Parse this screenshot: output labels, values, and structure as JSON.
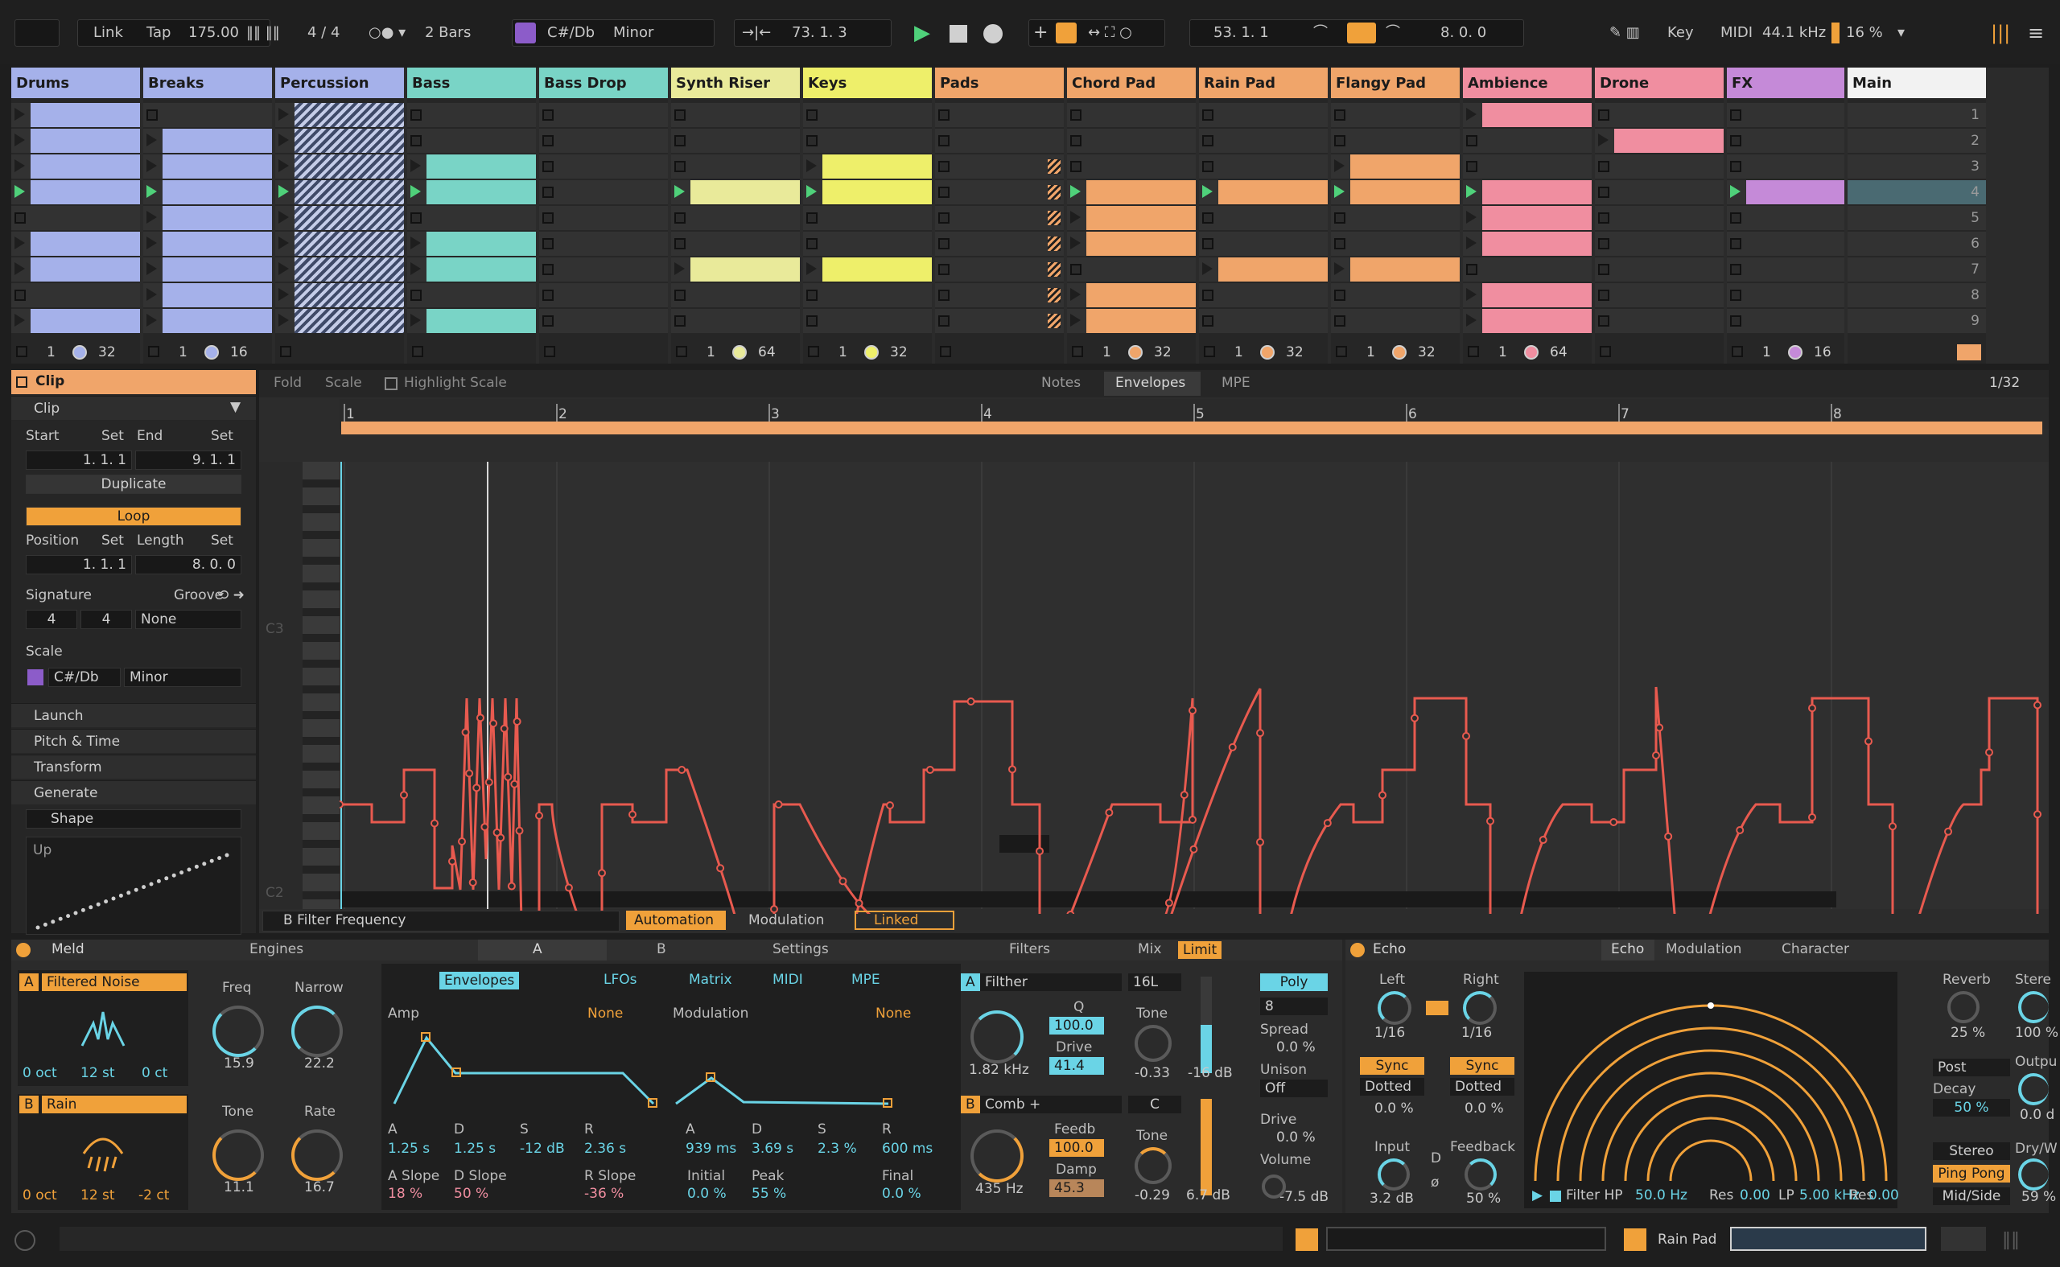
{
  "topbar": {
    "link": "Link",
    "tap": "Tap",
    "tempo": "175.00",
    "time_sig": "4 / 4",
    "quantize": "2 Bars",
    "key": "C#/Db",
    "scale": "Minor",
    "position": "73.   1.   3",
    "loop_start": "53.   1.   1",
    "loop_length": "8.   0.   0",
    "key_map": "Key",
    "midi_map": "MIDI",
    "sample_rate": "44.1 kHz",
    "cpu": "16 %"
  },
  "tracks": [
    {
      "name": "Drums",
      "color": "#a5b1ea",
      "slots": [
        1,
        1,
        1,
        1,
        0,
        1,
        1,
        0,
        1
      ],
      "playing": 3,
      "footer_num": "1",
      "footer_count": "32",
      "dot": "#a5b1ea"
    },
    {
      "name": "Breaks",
      "color": "#a5b1ea",
      "slots": [
        0,
        1,
        1,
        1,
        1,
        1,
        1,
        1,
        1
      ],
      "playing": 3,
      "footer_num": "1",
      "footer_count": "16",
      "dot": "#a5b1ea"
    },
    {
      "name": "Percussion",
      "color": "#a5b1ea",
      "hatch": true,
      "slots": [
        1,
        1,
        1,
        1,
        1,
        1,
        1,
        1,
        1
      ],
      "playing": 3,
      "footer_num": "",
      "footer_count": "",
      "dot": ""
    },
    {
      "name": "Bass",
      "color": "#79d4c6",
      "slots": [
        0,
        0,
        1,
        1,
        0,
        1,
        1,
        0,
        1
      ],
      "playing": 3,
      "footer_num": "",
      "footer_count": "",
      "dot": ""
    },
    {
      "name": "Bass Drop",
      "color": "#79d4c6",
      "slots": [
        0,
        0,
        0,
        0,
        0,
        0,
        0,
        0,
        0
      ],
      "playing": -1,
      "footer_num": "",
      "footer_count": "",
      "dot": ""
    },
    {
      "name": "Synth Riser",
      "color": "#e9ea9a",
      "slots": [
        0,
        0,
        0,
        1,
        0,
        0,
        1,
        0,
        0
      ],
      "playing": 3,
      "footer_num": "1",
      "footer_count": "64",
      "dot": "#e9ea9a"
    },
    {
      "name": "Keys",
      "color": "#eeef6a",
      "slots": [
        0,
        0,
        1,
        1,
        0,
        0,
        1,
        0,
        0
      ],
      "playing": 3,
      "footer_num": "1",
      "footer_count": "32",
      "dot": "#eeef6a"
    },
    {
      "name": "Pads",
      "color": "#f0a56a",
      "stripes": true,
      "slots": [
        0,
        0,
        0,
        0,
        0,
        0,
        0,
        0,
        0
      ],
      "playing": -1,
      "footer_num": "",
      "footer_count": "",
      "dot": ""
    },
    {
      "name": "Chord Pad",
      "color": "#f0a56a",
      "slots": [
        0,
        0,
        0,
        1,
        1,
        1,
        0,
        1,
        1
      ],
      "playing": 3,
      "footer_num": "1",
      "footer_count": "32",
      "dot": "#f0a56a"
    },
    {
      "name": "Rain Pad",
      "color": "#f0a56a",
      "slots": [
        0,
        0,
        0,
        1,
        0,
        0,
        1,
        0,
        0
      ],
      "playing": 3,
      "footer_num": "1",
      "footer_count": "32",
      "dot": "#f0a56a"
    },
    {
      "name": "Flangy Pad",
      "color": "#f0a56a",
      "slots": [
        0,
        0,
        1,
        1,
        0,
        0,
        1,
        0,
        0
      ],
      "playing": 3,
      "footer_num": "1",
      "footer_count": "32",
      "dot": "#f0a56a"
    },
    {
      "name": "Ambience",
      "color": "#f08ea0",
      "slots": [
        1,
        0,
        0,
        1,
        1,
        1,
        0,
        1,
        1
      ],
      "playing": 3,
      "footer_num": "1",
      "footer_count": "64",
      "dot": "#f08ea0"
    },
    {
      "name": "Drone",
      "color": "#f08ea0",
      "slots": [
        0,
        1,
        0,
        0,
        0,
        0,
        0,
        0,
        0
      ],
      "playing": -1,
      "footer_num": "",
      "footer_count": "",
      "dot": ""
    },
    {
      "name": "FX",
      "color": "#c58ad8",
      "slots": [
        0,
        0,
        0,
        1,
        0,
        0,
        0,
        0,
        0
      ],
      "playing": 3,
      "footer_num": "1",
      "footer_count": "16",
      "dot": "#c58ad8"
    },
    {
      "name": "Main",
      "color": "#f2f2f2",
      "slots": [
        0,
        0,
        0,
        0,
        0,
        0,
        0,
        0,
        0
      ],
      "playing": -1,
      "footer_num": "",
      "footer_count": "",
      "dot": ""
    }
  ],
  "scenes": [
    "1",
    "2",
    "3",
    "4",
    "5",
    "6",
    "7",
    "8",
    "9"
  ],
  "clip_panel": {
    "title": "Clip",
    "section": "Clip",
    "start_label": "Start",
    "end_label": "End",
    "set": "Set",
    "start": "1.   1.   1",
    "end": "9.   1.   1",
    "duplicate": "Duplicate",
    "loop": "Loop",
    "position_label": "Position",
    "length_label": "Length",
    "position": "1.   1.   1",
    "length": "8.   0.   0",
    "signature_label": "Signature",
    "groove_label": "Groove",
    "sig_num": "4",
    "sig_den": "4",
    "groove": "None",
    "scale_label": "Scale",
    "scale_key": "C#/Db",
    "scale_mode": "Minor",
    "sections": [
      "Launch",
      "Pitch & Time",
      "Transform",
      "Generate"
    ],
    "shape": "Shape",
    "shape_mode": "Up"
  },
  "editor": {
    "fold": "Fold",
    "scale": "Scale",
    "highlight": "Highlight Scale",
    "tabs": [
      "Notes",
      "Envelopes",
      "MPE"
    ],
    "grid": "1/32",
    "bars": [
      "1",
      "2",
      "3",
      "4",
      "5",
      "6",
      "7",
      "8"
    ],
    "pitch_c3": "C3",
    "pitch_c2": "C2",
    "param": "B Filter Frequency",
    "automation": "Automation",
    "modulation": "Modulation",
    "linked": "Linked",
    "envelope_color": "#e85a4f"
  },
  "meld": {
    "title": "Meld",
    "engines": "Engines",
    "tabs": [
      "A",
      "B",
      "Settings"
    ],
    "osc_a": "Filtered Noise",
    "osc_b": "Rain",
    "a_oct": "0 oct",
    "a_st": "12 st",
    "a_ct": "0 ct",
    "b_oct": "0 oct",
    "b_st": "12 st",
    "b_ct": "-2 ct",
    "freq_label": "Freq",
    "freq": "15.9",
    "narrow_label": "Narrow",
    "narrow": "22.2",
    "tone_label": "Tone",
    "tone": "11.1",
    "rate_label": "Rate",
    "rate": "16.7",
    "subtabs": [
      "Envelopes",
      "LFOs",
      "Matrix",
      "MIDI",
      "MPE"
    ],
    "amp": "Amp",
    "amp_mode": "None",
    "mod": "Modulation",
    "mod_mode": "None",
    "amp_a": "1.25 s",
    "amp_d": "1.25 s",
    "amp_s": "-12 dB",
    "amp_r": "2.36 s",
    "aslope": "18 %",
    "dslope": "50 %",
    "rslope": "-36 %",
    "mod_a": "939 ms",
    "mod_d": "3.69 s",
    "mod_s": "2.3 %",
    "mod_r": "600 ms",
    "initial": "0.0 %",
    "peak": "55 %",
    "final": "0.0 %",
    "letters": [
      "A",
      "D",
      "S",
      "R"
    ],
    "aslope_label": "A Slope",
    "dslope_label": "D Slope",
    "rslope_label": "R Slope",
    "initial_label": "Initial",
    "peak_label": "Peak",
    "final_label": "Final"
  },
  "filters": {
    "title": "Filters",
    "filter_a": "Filther",
    "freq_a": "1.82 kHz",
    "q_label": "Q",
    "q": "100.0",
    "drive_label": "Drive",
    "drive": "41.4",
    "filter_b": "Comb +",
    "freq_b": "435 Hz",
    "feedb_label": "Feedb",
    "feedb": "100.0",
    "damp_label": "Damp",
    "damp": "45.3"
  },
  "mix": {
    "title": "Mix",
    "limit": "Limit",
    "a": "16L",
    "tone_label": "Tone",
    "tone_a": "-0.33",
    "vol_a": "-16 dB",
    "b": "C",
    "tone_b": "-0.29",
    "vol_b": "6.7 dB",
    "poly": "Poly",
    "voices": "8",
    "spread_label": "Spread",
    "spread": "0.0 %",
    "unison_label": "Unison",
    "unison": "Off",
    "drive_label": "Drive",
    "drive": "0.0 %",
    "volume_label": "Volume",
    "volume": "-7.5 dB"
  },
  "echo": {
    "title": "Echo",
    "tabs": [
      "Echo",
      "Modulation",
      "Character"
    ],
    "left": "Left",
    "right": "Right",
    "left_val": "1/16",
    "right_val": "1/16",
    "sync": "Sync",
    "dotted": "Dotted",
    "left_pct": "0.0 %",
    "right_pct": "0.0 %",
    "input_label": "Input",
    "input": "3.2 dB",
    "feedback_label": "Feedback",
    "feedback": "50 %",
    "filter": "Filter HP",
    "hp": "50.0 Hz",
    "res_label": "Res",
    "res1": "0.00",
    "lp_label": "LP",
    "lp": "5.00 kHz",
    "res2": "0.00",
    "reverb_label": "Reverb",
    "reverb": "25 %",
    "stereo_label": "Stere",
    "stereo": "100 %",
    "post": "Post",
    "decay_label": "Decay",
    "decay": "50 %",
    "output_label": "Outpu",
    "output": "0.0 d",
    "stereo_btn": "Stereo",
    "pingpong": "Ping Pong",
    "midside": "Mid/Side",
    "drywet_label": "Dry/W",
    "drywet": "59 %",
    "d": "D"
  },
  "status": {
    "track": "Rain Pad"
  }
}
